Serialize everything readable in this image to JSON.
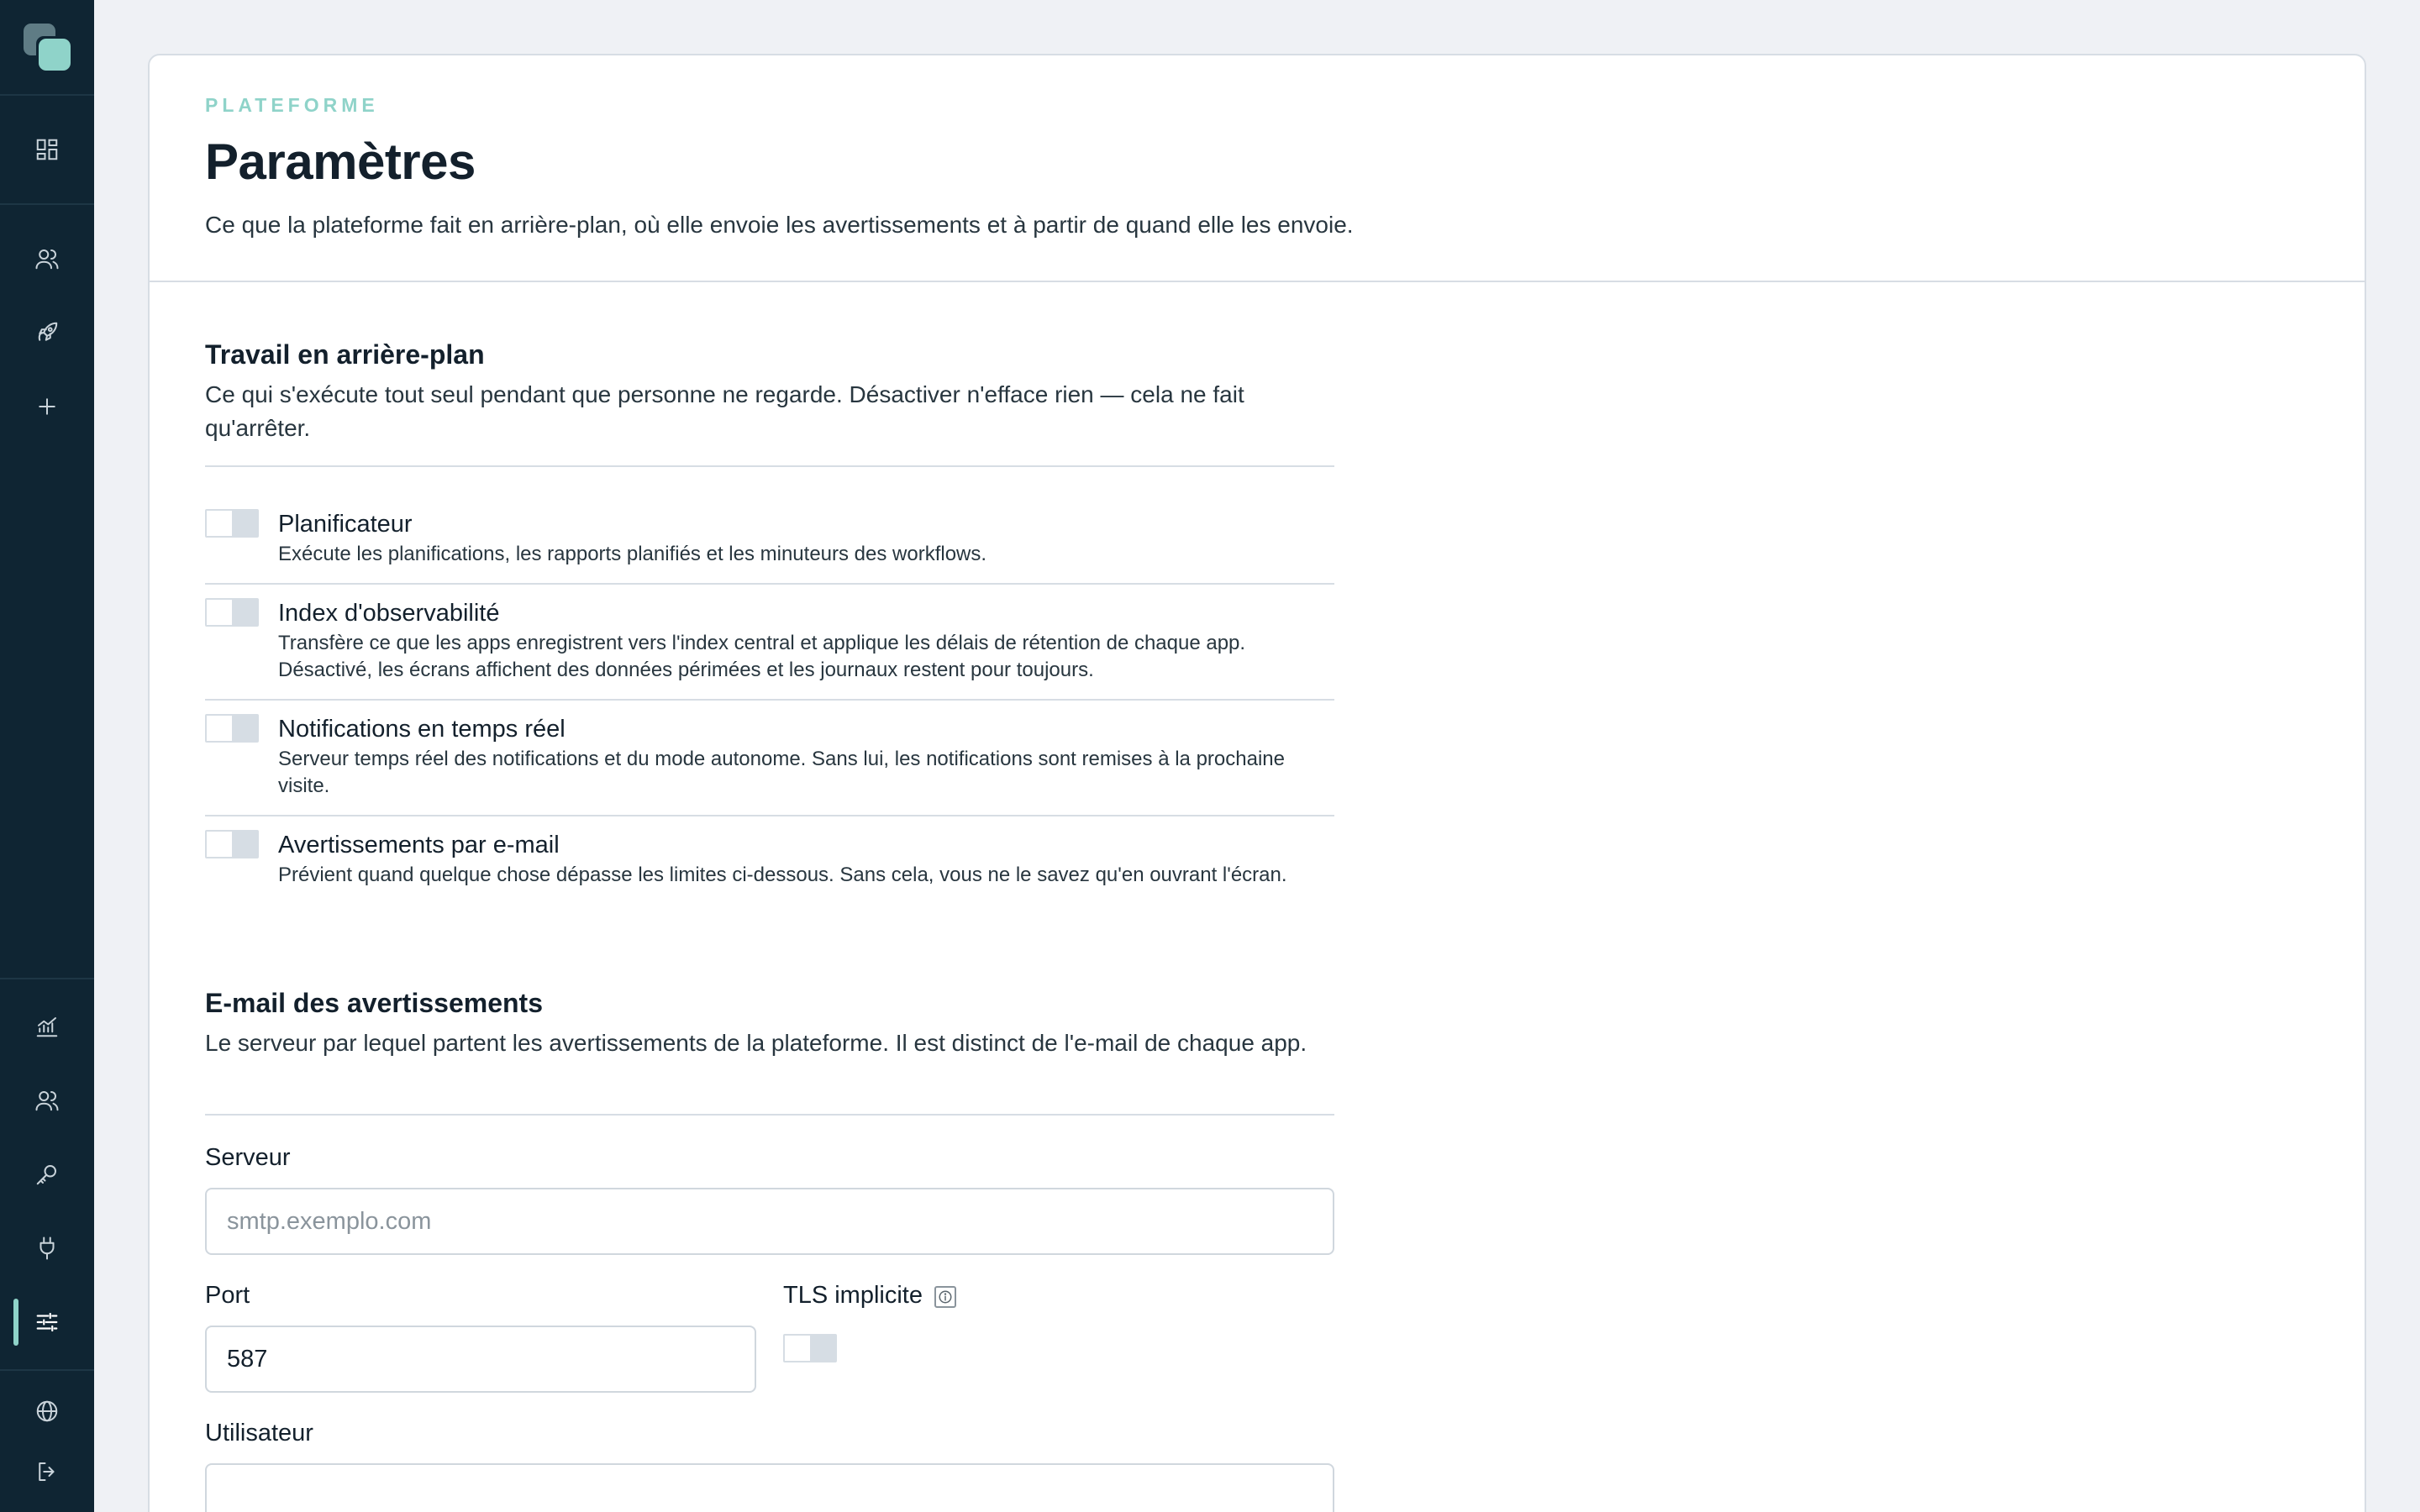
{
  "sidebar": {
    "logo": "logo",
    "top_icons": [
      "dashboard-icon",
      "users-icon",
      "rocket-icon",
      "plus-icon"
    ],
    "bottom_icons": [
      "analytics-icon",
      "team-icon",
      "key-icon",
      "plug-icon",
      "settings-sliders-icon",
      "globe-icon",
      "logout-icon"
    ],
    "active": "settings-sliders-icon",
    "accent": "#8fd3c9",
    "background": "#0f2533"
  },
  "header": {
    "eyebrow": "PLATEFORME",
    "title": "Paramètres",
    "subtitle": "Ce que la plateforme fait en arrière-plan, où elle envoie les avertissements et à partir de quand elle les envoie."
  },
  "background_work": {
    "title": "Travail en arrière-plan",
    "description": "Ce qui s'exécute tout seul pendant que personne ne regarde. Désactiver n'efface rien — cela ne fait qu'arrêter.",
    "options": [
      {
        "title": "Planificateur",
        "description": "Exécute les planifications, les rapports planifiés et les minuteurs des workflows.",
        "enabled": false
      },
      {
        "title": "Index d'observabilité",
        "description": "Transfère ce que les apps enregistrent vers l'index central et applique les délais de rétention de chaque app. Désactivé, les écrans affichent des données périmées et les journaux restent pour toujours.",
        "enabled": false
      },
      {
        "title": "Notifications en temps réel",
        "description": "Serveur temps réel des notifications et du mode autonome. Sans lui, les notifications sont remises à la prochaine visite.",
        "enabled": false
      },
      {
        "title": "Avertissements par e-mail",
        "description": "Prévient quand quelque chose dépasse les limites ci-dessous. Sans cela, vous ne le savez qu'en ouvrant l'écran.",
        "enabled": false
      }
    ]
  },
  "alert_email": {
    "title": "E-mail des avertissements",
    "description": "Le serveur par lequel partent les avertissements de la plateforme. Il est distinct de l'e-mail de chaque app.",
    "server_label": "Serveur",
    "server_placeholder": "smtp.exemplo.com",
    "server_value": "",
    "port_label": "Port",
    "port_value": "587",
    "tls_label": "TLS implicite",
    "tls_enabled": false,
    "user_label": "Utilisateur",
    "user_value": ""
  }
}
